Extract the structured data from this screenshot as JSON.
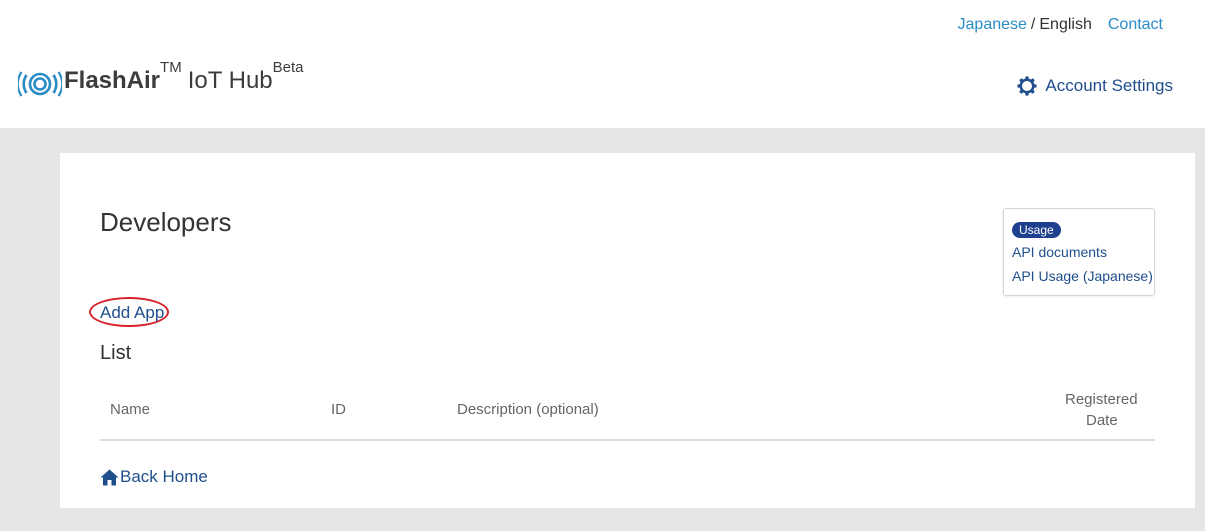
{
  "header": {
    "lang_japanese": "Japanese",
    "lang_separator": "/",
    "lang_english": "English",
    "contact": "Contact",
    "logo_brand": "FlashAir",
    "logo_tm": "TM",
    "logo_product": "IoT Hub",
    "logo_beta": "Beta",
    "account_settings": "Account Settings"
  },
  "main": {
    "title": "Developers",
    "usage": {
      "badge": "Usage",
      "links": [
        "API documents",
        "API Usage (Japanese)"
      ]
    },
    "add_app": "Add App",
    "list_title": "List",
    "table": {
      "headers": [
        "Name",
        "ID",
        "Description (optional)",
        "Registered",
        "Date"
      ]
    },
    "back_home": "Back Home"
  },
  "colors": {
    "link_blue": "#2a8cc7",
    "dark_blue": "#1f4e8c",
    "badge_blue": "#1f3f8f",
    "highlight_red": "#d8232a",
    "page_bg": "#e6e6e6"
  },
  "icons": [
    "wifi-signal-icon",
    "gear-icon",
    "home-icon"
  ]
}
